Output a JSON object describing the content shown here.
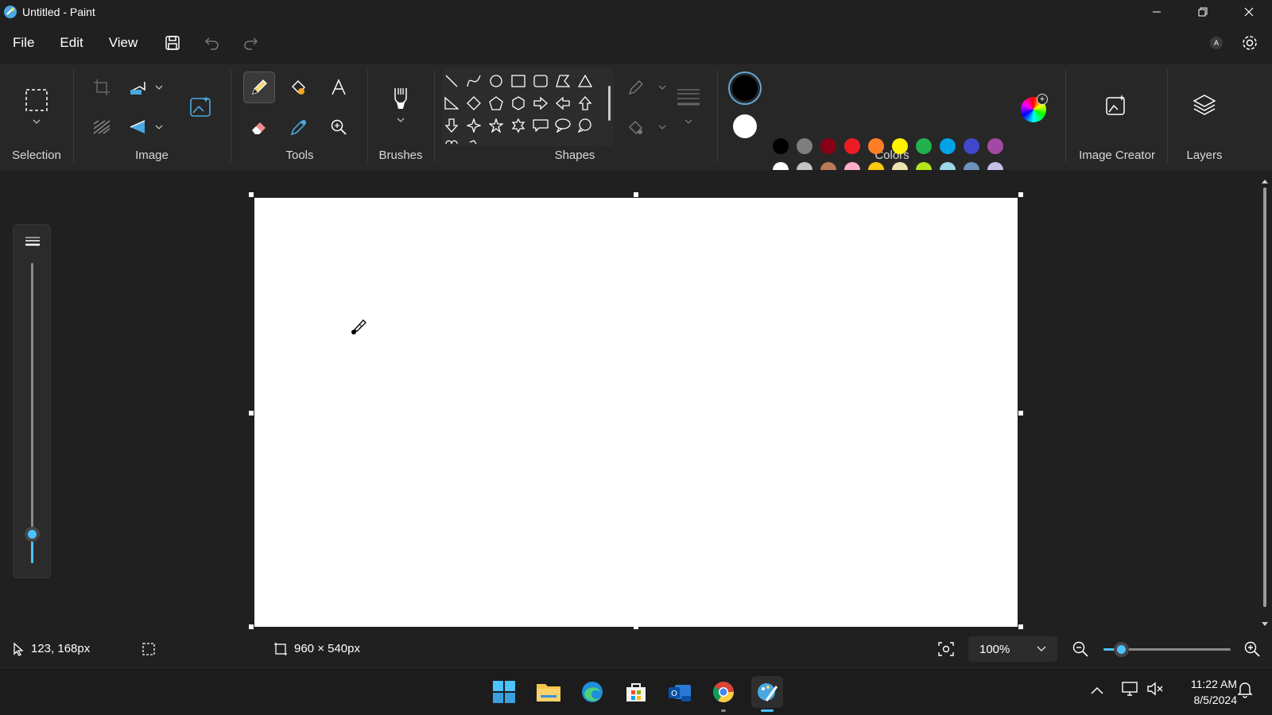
{
  "window": {
    "title": "Untitled - Paint"
  },
  "menu": {
    "file": "File",
    "edit": "Edit",
    "view": "View",
    "account_initial": "A"
  },
  "ribbon": {
    "selection_label": "Selection",
    "image_label": "Image",
    "tools_label": "Tools",
    "brushes_label": "Brushes",
    "shapes_label": "Shapes",
    "colors_label": "Colors",
    "image_creator_label": "Image Creator",
    "layers_label": "Layers",
    "active_tool": "pencil"
  },
  "colors": {
    "primary": "#000000",
    "secondary": "#ffffff",
    "accent": "#4cc2ff",
    "palette_row1": [
      "#000000",
      "#7f7f7f",
      "#880015",
      "#ed1c24",
      "#ff7f27",
      "#fff200",
      "#22b14c",
      "#00a2e8",
      "#3f48cc",
      "#a349a4"
    ],
    "palette_row2": [
      "#ffffff",
      "#c3c3c3",
      "#b97a57",
      "#ffaec9",
      "#ffc90e",
      "#efe4b0",
      "#b5e61d",
      "#99d9ea",
      "#7092be",
      "#c8bfe7"
    ],
    "custom_slots": 10
  },
  "brush_size": {
    "level": 0.1
  },
  "status": {
    "cursor_position": "123, 168px",
    "canvas_size": "960 × 540px",
    "zoom": "100%",
    "zoom_level": 0.14
  },
  "taskbar": {
    "time": "11:22 AM",
    "date": "8/5/2024"
  }
}
